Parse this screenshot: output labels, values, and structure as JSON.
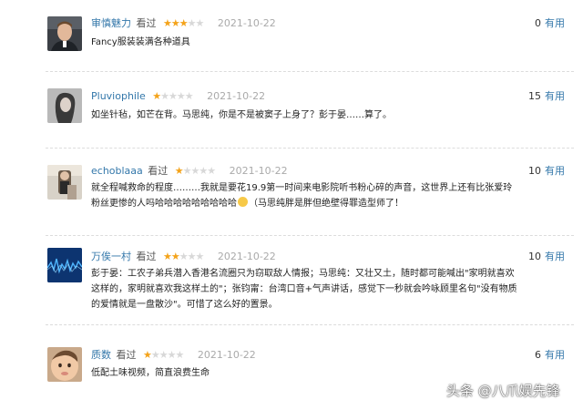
{
  "reviews": [
    {
      "username": "审慎魅力",
      "rating_text": "看过",
      "rating": 3,
      "date": "2021-10-22",
      "votes": "0",
      "useful_label": "有用",
      "text": "Fancy服装装满各种道具"
    },
    {
      "username": "Pluviophile",
      "rating_text": "看过",
      "rating": 1,
      "date": "2021-10-22",
      "votes": "15",
      "useful_label": "有用",
      "text": "如坐针毡，如芒在背。马思纯，你是不是被窦子上身了？彭于晏……算了。"
    },
    {
      "username": "echoblaaa",
      "rating_text": "看过",
      "rating": 1,
      "date": "2021-10-22",
      "votes": "10",
      "useful_label": "有用",
      "text_before_emoji": "就全程喊救命的程度………我就是要花19.9第一时间来电影院听书粉心碎的声音，这世界上还有比张爱玲粉丝更惨的人吗哈哈哈哈哈哈哈哈哈",
      "text_after_emoji": "（马思纯胖是胖但绝壁得罪造型师了！"
    },
    {
      "username": "万俟一村",
      "rating_text": "看过",
      "rating": 2,
      "date": "2021-10-22",
      "votes": "10",
      "useful_label": "有用",
      "text": "彭于晏：工农子弟兵潜入香港名流圈只为窃取敌人情报；马思纯：又壮又土，随时都可能喊出\"家明就喜欢这样的，家明就喜欢我这样土的\"；张钧甯：台湾口音+气声讲话，感觉下一秒就会吟咏顾里名句\"没有物质的爱情就是一盘散沙\"。可惜了这么好的置景。"
    },
    {
      "username": "质数",
      "rating_text": "看过",
      "rating": 1,
      "date": "2021-10-22",
      "votes": "6",
      "useful_label": "有用",
      "text": "低配土味视频，简直浪费生命"
    }
  ],
  "watermark": "头条 @八爪娱先锋",
  "colors": {
    "username": "#3377aa",
    "star_on": "#f4a31a",
    "star_off": "#d8d8d8",
    "date": "#aaaaaa"
  }
}
